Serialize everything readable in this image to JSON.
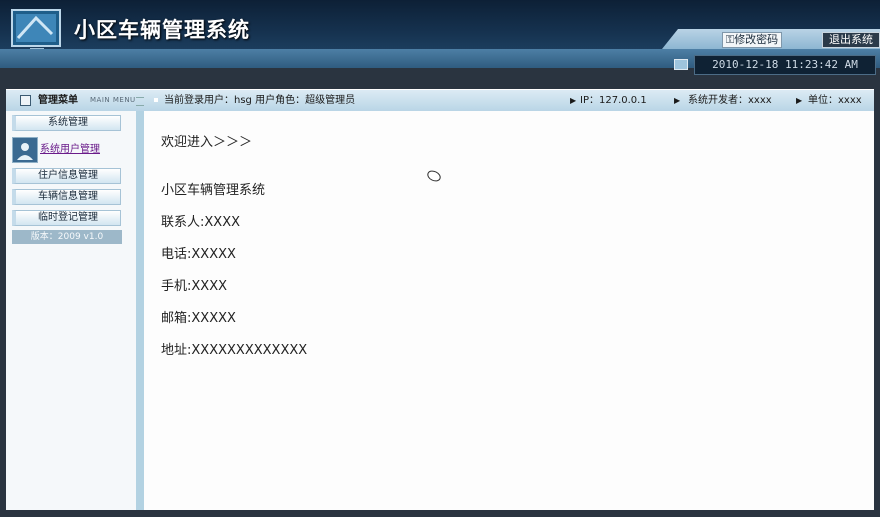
{
  "header": {
    "app_title": "小区车辆管理系统",
    "change_password_label": "修改密码",
    "logout_label": "退出系统",
    "datetime": "2010-12-18 11:23:42 AM"
  },
  "info_bar": {
    "menu_title": "管理菜单",
    "menu_subtitle": "MAIN MENU",
    "current_user": "当前登录用户：hsg  用户角色：超级管理员",
    "ip": "IP：127.0.0.1",
    "developer": "系统开发者：xxxx",
    "unit": "单位：xxxx"
  },
  "sidebar": {
    "items": [
      {
        "label": "系统管理"
      },
      {
        "label": "系统用户管理"
      },
      {
        "label": "住户信息管理"
      },
      {
        "label": "车辆信息管理"
      },
      {
        "label": "临时登记管理"
      }
    ],
    "version": "版本：2009 v1.0"
  },
  "main": {
    "welcome": "欢迎进入＞＞＞",
    "system_name": "小区车辆管理系统",
    "contact": "联系人:XXXX",
    "phone": "电话:XXXXX",
    "mobile": "手机:XXXX",
    "email": "邮箱:XXXXX",
    "address": "地址:XXXXXXXXXXXXX"
  },
  "colors": {
    "header_dark": "#15314e",
    "info_bar": "#c6deeb",
    "sidebar_edge": "#b3d2e2",
    "active_link": "#6a1b8a"
  },
  "icons": [
    "monitor-logo-icon",
    "key-icon",
    "clock-icon",
    "menu-icon",
    "user-manage-icon",
    "mouse-cursor-icon"
  ]
}
